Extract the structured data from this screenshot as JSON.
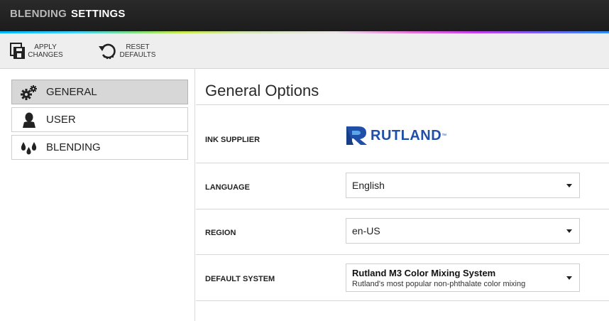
{
  "topnav": {
    "tabs": [
      {
        "label": "BLENDING",
        "active": false
      },
      {
        "label": "SETTINGS",
        "active": true
      }
    ]
  },
  "toolbar": {
    "apply_label_1": "APPLY",
    "apply_label_2": "CHANGES",
    "reset_label_1": "RESET",
    "reset_label_2": "DEFAULTS"
  },
  "sidebar": {
    "items": [
      {
        "label": "GENERAL",
        "icon": "gears-icon",
        "active": true
      },
      {
        "label": "USER",
        "icon": "user-icon",
        "active": false
      },
      {
        "label": "BLENDING",
        "icon": "drops-icon",
        "active": false
      }
    ]
  },
  "main": {
    "title": "General Options",
    "rows": {
      "ink_supplier": {
        "label": "INK SUPPLIER",
        "logo_text": "RUTLAND",
        "logo_mark": "™"
      },
      "language": {
        "label": "LANGUAGE",
        "value": "English"
      },
      "region": {
        "label": "REGION",
        "value": "en-US"
      },
      "default_system": {
        "label": "DEFAULT SYSTEM",
        "title": "Rutland M3 Color Mixing System",
        "subtitle": "Rutland's most popular non-phthalate color mixing"
      }
    }
  },
  "colors": {
    "nav_bg": "#1c1c1c",
    "nav_active": "#ffffff",
    "nav_inactive": "#b9b9b9",
    "toolbar_bg": "#eeeeee",
    "sidebar_active_bg": "#d7d7d7",
    "brand_blue": "#1f4fa8"
  }
}
